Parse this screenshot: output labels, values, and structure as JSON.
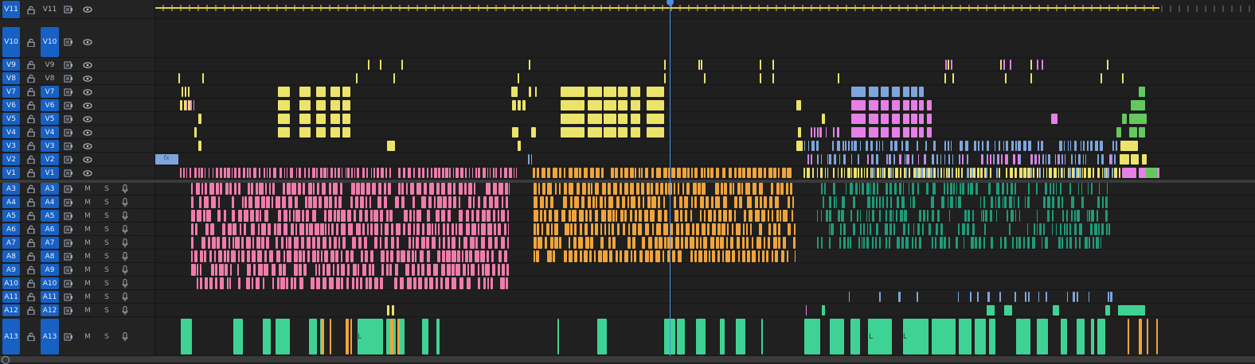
{
  "colors": {
    "track_blue": "#1760c4",
    "playhead": "#4d8fe0",
    "in_out": "#e6d33a",
    "pink": "#f07cac",
    "orange": "#f0a43c",
    "yellow": "#ece36a",
    "magenta": "#e480e6",
    "blue": "#7ea6dc",
    "green": "#3ed394",
    "lime": "#64c85c",
    "teal": "#1e9c78"
  },
  "icons": {
    "lock": "lock-icon",
    "sync": "sync-lock-icon",
    "eye": "eye-icon",
    "mic": "mic-icon"
  },
  "playhead": {
    "time_fraction": 0.468
  },
  "video_tracks": [
    {
      "id": "v11",
      "source": "V11",
      "target": "V11",
      "source_hl": true,
      "target_hl": false
    },
    {
      "id": "v10",
      "source": "V10",
      "target": "V10",
      "source_hl": true,
      "target_hl": true
    },
    {
      "id": "v9",
      "source": "V9",
      "target": "V9",
      "source_hl": true,
      "target_hl": false
    },
    {
      "id": "v8",
      "source": "V8",
      "target": "V8",
      "source_hl": true,
      "target_hl": false
    },
    {
      "id": "v7",
      "source": "V7",
      "target": "V7",
      "source_hl": true,
      "target_hl": true
    },
    {
      "id": "v6",
      "source": "V6",
      "target": "V6",
      "source_hl": true,
      "target_hl": true
    },
    {
      "id": "v5",
      "source": "V5",
      "target": "V5",
      "source_hl": true,
      "target_hl": true
    },
    {
      "id": "v4",
      "source": "V4",
      "target": "V4",
      "source_hl": true,
      "target_hl": true
    },
    {
      "id": "v3",
      "source": "V3",
      "target": "V3",
      "source_hl": true,
      "target_hl": true
    },
    {
      "id": "v2",
      "source": "V2",
      "target": "V2",
      "source_hl": true,
      "target_hl": true
    },
    {
      "id": "v1",
      "source": "V1",
      "target": "V1",
      "source_hl": true,
      "target_hl": true
    }
  ],
  "audio_tracks": [
    {
      "id": "a3",
      "source": "A3",
      "target": "A3",
      "mute": "M",
      "solo": "S"
    },
    {
      "id": "a4",
      "source": "A4",
      "target": "A4",
      "mute": "M",
      "solo": "S"
    },
    {
      "id": "a5",
      "source": "A5",
      "target": "A5",
      "mute": "M",
      "solo": "S"
    },
    {
      "id": "a6",
      "source": "A6",
      "target": "A6",
      "mute": "M",
      "solo": "S"
    },
    {
      "id": "a7",
      "source": "A7",
      "target": "A7",
      "mute": "M",
      "solo": "S"
    },
    {
      "id": "a8",
      "source": "A8",
      "target": "A8",
      "mute": "M",
      "solo": "S"
    },
    {
      "id": "a9",
      "source": "A9",
      "target": "A9",
      "mute": "M",
      "solo": "S"
    },
    {
      "id": "a10",
      "source": "A10",
      "target": "A10",
      "mute": "M",
      "solo": "S"
    },
    {
      "id": "a11",
      "source": "A11",
      "target": "A11",
      "mute": "M",
      "solo": "S"
    },
    {
      "id": "a12",
      "source": "A12",
      "target": "A12",
      "mute": "M",
      "solo": "S"
    },
    {
      "id": "a13",
      "source": "A13",
      "target": "A13",
      "mute": "M",
      "solo": "S"
    }
  ],
  "clip_labels": {
    "fx_badge": "fx",
    "link_badge": "L"
  }
}
